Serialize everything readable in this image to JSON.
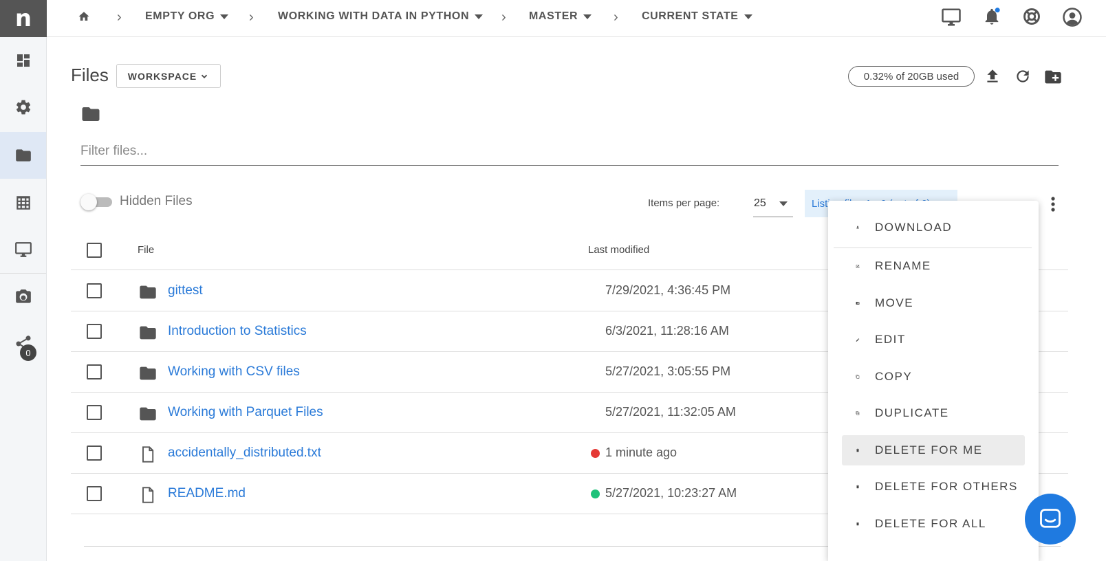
{
  "brand": {
    "logo_letter": "n"
  },
  "sidebar": {
    "items": [
      {
        "name": "dashboard-icon"
      },
      {
        "name": "gear-icon"
      },
      {
        "name": "folder-icon"
      },
      {
        "name": "table-icon"
      },
      {
        "name": "monitor-icon"
      },
      {
        "name": "camera-icon"
      },
      {
        "name": "share-icon",
        "badge": "0"
      }
    ]
  },
  "breadcrumb": {
    "org": "EMPTY ORG",
    "project": "WORKING WITH DATA IN PYTHON",
    "branch": "MASTER",
    "state": "CURRENT STATE"
  },
  "files": {
    "title": "Files",
    "workspace_label": "WORKSPACE",
    "storage_label": "0.32% of 20GB used",
    "filter_placeholder": "Filter files...",
    "hidden_files_label": "Hidden Files",
    "items_per_page_label": "Items per page:",
    "items_per_page_value": "25",
    "listing_text": "Listing files 1 - 6 (out of 6)",
    "columns": {
      "file": "File",
      "last_modified": "Last modified"
    },
    "rows": [
      {
        "name": "gittest",
        "type": "folder",
        "modified": "7/29/2021, 4:36:45 PM",
        "status": ""
      },
      {
        "name": "Introduction to Statistics",
        "type": "folder",
        "modified": "6/3/2021, 11:28:16 AM",
        "status": ""
      },
      {
        "name": "Working with CSV files",
        "type": "folder",
        "modified": "5/27/2021, 3:05:55 PM",
        "status": ""
      },
      {
        "name": "Working with Parquet Files",
        "type": "folder",
        "modified": "5/27/2021, 11:32:05 AM",
        "status": ""
      },
      {
        "name": "accidentally_distributed.txt",
        "type": "file",
        "modified": "1 minute ago",
        "status": "#e53935"
      },
      {
        "name": "README.md",
        "type": "file",
        "modified": "5/27/2021, 10:23:27 AM",
        "status": "#1ec27a"
      }
    ]
  },
  "context_menu": {
    "items": [
      {
        "label": "DOWNLOAD",
        "icon": "download-icon"
      },
      {
        "label": "RENAME",
        "icon": "rename-icon"
      },
      {
        "label": "MOVE",
        "icon": "move-icon"
      },
      {
        "label": "EDIT",
        "icon": "pencil-icon"
      },
      {
        "label": "COPY",
        "icon": "copy-icon"
      },
      {
        "label": "DUPLICATE",
        "icon": "duplicate-icon"
      },
      {
        "label": "DELETE FOR ME",
        "icon": "trash-icon"
      },
      {
        "label": "DELETE FOR OTHERS",
        "icon": "trash-icon"
      },
      {
        "label": "DELETE FOR ALL",
        "icon": "trash-icon"
      }
    ]
  },
  "colors": {
    "accent": "#2a7ad8",
    "chat": "#1f7ae0"
  }
}
